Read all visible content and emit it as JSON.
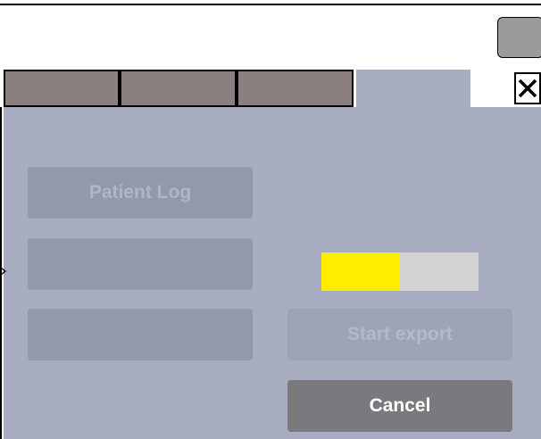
{
  "tabs": [
    {
      "label": ""
    },
    {
      "label": ""
    },
    {
      "label": ""
    },
    {
      "label": "",
      "active": true
    }
  ],
  "menu": {
    "items": [
      {
        "label": "Patient Log",
        "enabled": false
      },
      {
        "label": "",
        "enabled": false
      },
      {
        "label": "",
        "enabled": false
      }
    ]
  },
  "export": {
    "progress_fraction": 0.5,
    "start_label": "Start export",
    "cancel_label": "Cancel"
  },
  "icons": {
    "close": "close-icon",
    "edge": "chevron-right-icon"
  },
  "colors": {
    "panel": "#a8adc1",
    "tab_inactive": "#8c7f80",
    "progress_fill": "#ffee00",
    "progress_track": "#d4d4d6",
    "cancel_button": "#7a7a7e"
  }
}
